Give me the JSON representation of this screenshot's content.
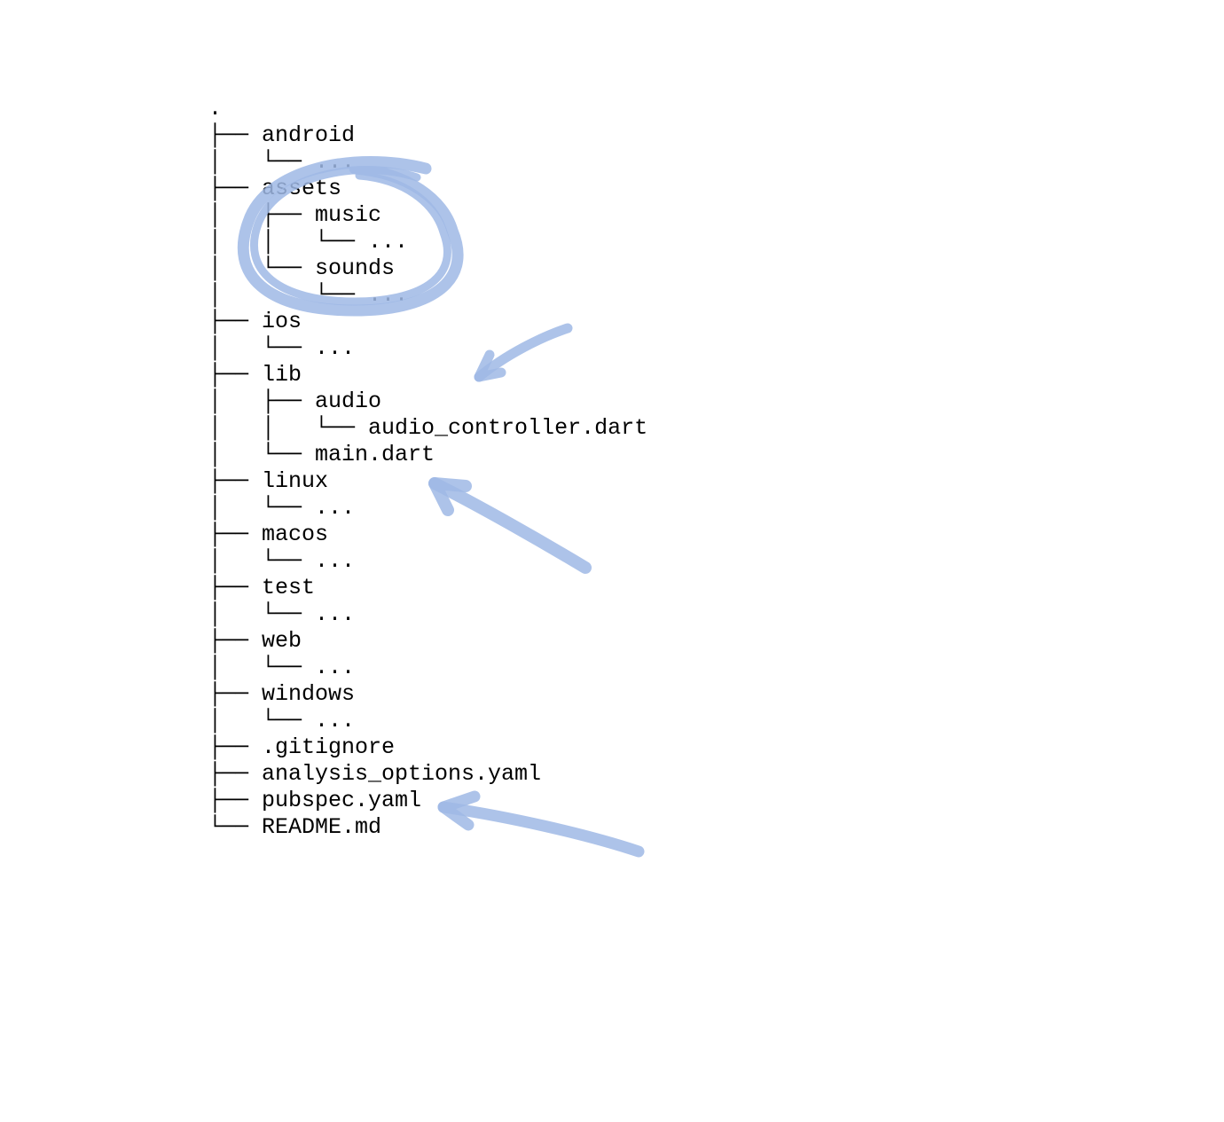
{
  "tree_lines": [
    ".",
    "├── android",
    "│   └── ...",
    "├── assets",
    "│   ├── music",
    "│   │   └── ...",
    "│   └── sounds",
    "│       └── ...",
    "├── ios",
    "│   └── ...",
    "├── lib",
    "│   ├── audio",
    "│   │   └── audio_controller.dart",
    "│   └── main.dart",
    "├── linux",
    "│   └── ...",
    "├── macos",
    "│   └── ...",
    "├── test",
    "│   └── ...",
    "├── web",
    "│   └── ...",
    "├── windows",
    "│   └── ...",
    "├── .gitignore",
    "├── analysis_options.yaml",
    "├── pubspec.yaml",
    "└── README.md"
  ],
  "annotations": {
    "circle_target": "assets",
    "arrow1_target": "lib/audio",
    "arrow2_target": "main.dart",
    "arrow3_target": "pubspec.yaml",
    "color": "#9fb9e5"
  }
}
